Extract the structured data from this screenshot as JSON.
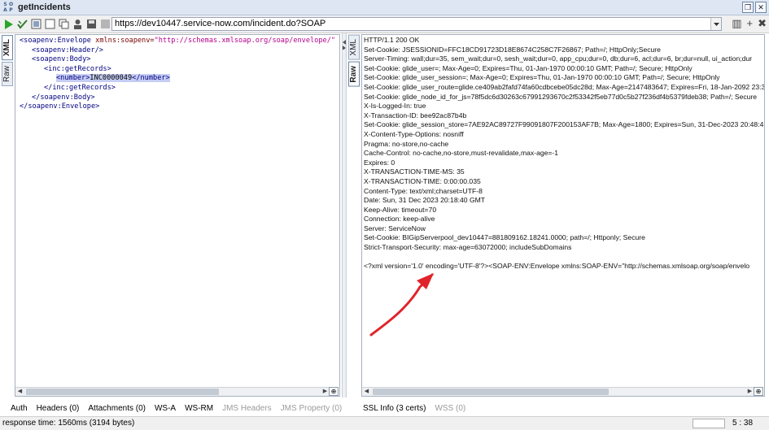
{
  "window": {
    "title": "getIncidents",
    "logo_letters": [
      "S",
      "O",
      "A",
      "P"
    ],
    "url": "https://dev10447.service-now.com/incident.do?SOAP"
  },
  "request": {
    "tabs": [
      "XML",
      "Raw"
    ],
    "xml_lines": [
      {
        "indent": 0,
        "parts": [
          [
            "t",
            "<soapenv:Envelope "
          ],
          [
            "a",
            "xmlns:soapenv="
          ],
          [
            "s",
            "\"http://schemas.xmlsoap.org/soap/envelope/\""
          ]
        ]
      },
      {
        "indent": 1,
        "parts": [
          [
            "t",
            "<soapenv:Header/>"
          ]
        ]
      },
      {
        "indent": 1,
        "parts": [
          [
            "t",
            "<soapenv:Body>"
          ]
        ]
      },
      {
        "indent": 2,
        "parts": [
          [
            "t",
            "<inc:getRecords>"
          ]
        ]
      },
      {
        "indent": 3,
        "highlight": true,
        "parts": [
          [
            "t",
            "<number>"
          ],
          [
            "v",
            "INC0000049"
          ],
          [
            "t",
            "</number>"
          ]
        ]
      },
      {
        "indent": 2,
        "parts": [
          [
            "t",
            "</inc:getRecords>"
          ]
        ]
      },
      {
        "indent": 1,
        "parts": [
          [
            "t",
            "</soapenv:Body>"
          ]
        ]
      },
      {
        "indent": 0,
        "parts": [
          [
            "t",
            "</soapenv:Envelope>"
          ]
        ]
      }
    ],
    "bottom_tabs": [
      {
        "label": "Auth",
        "enabled": true
      },
      {
        "label": "Headers (0)",
        "enabled": true
      },
      {
        "label": "Attachments (0)",
        "enabled": true
      },
      {
        "label": "WS-A",
        "enabled": true
      },
      {
        "label": "WS-RM",
        "enabled": true
      },
      {
        "label": "JMS Headers",
        "enabled": false
      },
      {
        "label": "JMS Property (0)",
        "enabled": false
      }
    ]
  },
  "response": {
    "tabs": [
      "XML",
      "Raw"
    ],
    "raw_lines": [
      "HTTP/1.1 200 OK",
      "Set-Cookie: JSESSIONID=FFC18CD91723D18E8674C258C7F26867; Path=/; HttpOnly;Secure",
      "Server-Timing: wall;dur=35, sem_wait;dur=0, sesh_wait;dur=0, app_cpu;dur=0, db;dur=6, acl;dur=6, br;dur=null, ui_action;dur",
      "Set-Cookie: glide_user=; Max-Age=0; Expires=Thu, 01-Jan-1970 00:00:10 GMT; Path=/; Secure; HttpOnly",
      "Set-Cookie: glide_user_session=; Max-Age=0; Expires=Thu, 01-Jan-1970 00:00:10 GMT; Path=/; Secure; HttpOnly",
      "Set-Cookie: glide_user_route=glide.ce409ab2fafd74fa60cdbcebe05dc28d; Max-Age=2147483647; Expires=Fri, 18-Jan-2092 23:3",
      "Set-Cookie: glide_node_id_for_js=78f5dc6d30263c67991293670c2f53342f5eb77d0c5b27f236df4b5379fdeb38; Path=/; Secure",
      "X-Is-Logged-In: true",
      "X-Transaction-ID: bee92ac87b4b",
      "Set-Cookie: glide_session_store=7AE92AC89727F99091807F200153AF7B; Max-Age=1800; Expires=Sun, 31-Dec-2023 20:48:41 G",
      "X-Content-Type-Options: nosniff",
      "Pragma: no-store,no-cache",
      "Cache-Control: no-cache,no-store,must-revalidate,max-age=-1",
      "Expires: 0",
      "X-TRANSACTION-TIME-MS: 35",
      "X-TRANSACTION-TIME: 0:00:00.035",
      "Content-Type: text/xml;charset=UTF-8",
      "Date: Sun, 31 Dec 2023 20:18:40 GMT",
      "Keep-Alive: timeout=70",
      "Connection: keep-alive",
      "Server: ServiceNow",
      "Set-Cookie: BIGipServerpool_dev10447=881809162.18241.0000; path=/; Httponly; Secure",
      "Strict-Transport-Security: max-age=63072000; includeSubDomains",
      "",
      "<?xml version='1.0' encoding='UTF-8'?><SOAP-ENV:Envelope xmlns:SOAP-ENV=\"http://schemas.xmlsoap.org/soap/envelo"
    ],
    "bottom_tabs": [
      {
        "label": "SSL Info (3 certs)",
        "enabled": true
      },
      {
        "label": "WSS (0)",
        "enabled": false
      }
    ]
  },
  "status": {
    "response_time": "response time: 1560ms (3194 bytes)",
    "cursor_pos": "5 : 38"
  },
  "colors": {
    "annotation_arrow": "#e0242a",
    "highlight": "#c6cdf3"
  },
  "icons": {
    "run": "run-icon",
    "validate": "validate-icon",
    "export": "export-icon",
    "maximize": "maximize-icon",
    "copy": "copy-icon",
    "stop": "stop-icon",
    "close": "close-icon"
  }
}
